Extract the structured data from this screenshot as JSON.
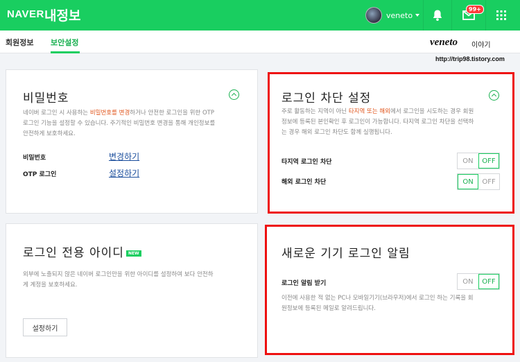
{
  "header": {
    "brand": "NAVER",
    "title": "내정보",
    "username": "veneto",
    "mail_badge": "99+"
  },
  "tabs": [
    {
      "label": "회원정보",
      "active": false
    },
    {
      "label": "보안설정",
      "active": true
    }
  ],
  "watermark": {
    "name": "veneto",
    "suffix": "이야기",
    "url": "http://trip98.tistory.com"
  },
  "password_card": {
    "title": "비밀번호",
    "desc_line1_pre": "네이버 로그인 시 사용하는 ",
    "desc_line1_hl": "비밀번호를 변경",
    "desc_line1_post": "하거나 안전한 로그인을 위한 OTP",
    "desc_line2": "로그인 기능을 설정할 수 있습니다. 주기적인 비밀번호 변경을 통해 개인정보를",
    "desc_line3": "안전하게 보호하세요.",
    "rows": [
      {
        "label": "비밀번호",
        "link": "변경하기"
      },
      {
        "label": "OTP 로그인",
        "link": "설정하기"
      }
    ]
  },
  "block_card": {
    "title": "로그인 차단 설정",
    "desc_line1_pre": "주로 활동하는 지역이 아닌 ",
    "desc_line1_hl": "타지역 또는 해외",
    "desc_line1_post": "에서 로그인을 시도하는 경우 회원",
    "desc_line2": "정보에 등록된 본인확인 후 로그인이 가능합니다. 타지역 로그인 차단을 선택하",
    "desc_line3": "는 경우 해외 로그인 차단도 함께 실행됩니다.",
    "rows": [
      {
        "label": "타지역 로그인 차단",
        "on": "ON",
        "off": "OFF",
        "state": "off"
      },
      {
        "label": "해외 로그인 차단",
        "on": "ON",
        "off": "OFF",
        "state": "on"
      }
    ]
  },
  "dedicated_card": {
    "title": "로그인 전용 아이디",
    "badge": "NEW",
    "desc_line1": "외부에 노출되지 않은 네이버 로그인만을 위한 아이디를 설정하여 보다 안전하",
    "desc_line2": "게 계정을 보호하세요.",
    "button": "설정하기"
  },
  "alert_card": {
    "title": "새로운 기기 로그인 알림",
    "row": {
      "label": "로그인 알림 받기",
      "on": "ON",
      "off": "OFF",
      "state": "off"
    },
    "desc_line1": "이전에 사용한 적 없는 PC나 모바일기기(브라우저)에서 로그인 하는 기록을 회",
    "desc_line2": "원정보에 등록된 메일로 알려드립니다."
  }
}
